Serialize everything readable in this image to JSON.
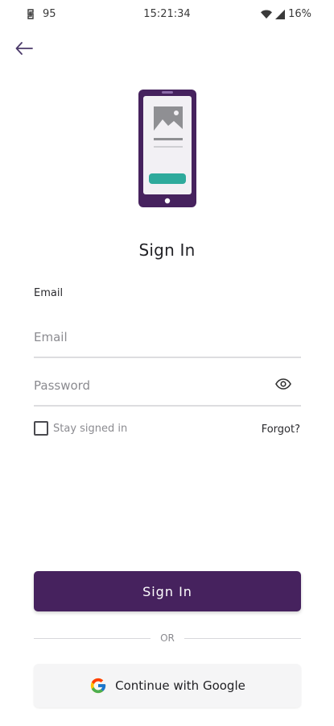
{
  "status_bar": {
    "notification_count": "95",
    "time": "15:21:34",
    "battery": "16%",
    "icons": [
      "notification-app-icon",
      "wifi-icon",
      "signal-icon"
    ]
  },
  "header": {
    "back_icon": "arrow-left-icon"
  },
  "illustration": {
    "icon": "phone-illustration-icon",
    "colors": {
      "frame": "#46225e",
      "screen": "#f2f0f4",
      "accent": "#2eaa9c",
      "image": "#8f8f93"
    }
  },
  "title": "Sign In",
  "form": {
    "email_label": "Email",
    "email_placeholder": "Email",
    "email_value": "",
    "password_placeholder": "Password",
    "password_value": "",
    "show_password_icon": "eye-icon",
    "stay_signed_in_label": "Stay signed in",
    "stay_signed_in_checked": false,
    "forgot_label": "Forgot?"
  },
  "actions": {
    "sign_in_label": "Sign In",
    "or_text": "OR",
    "google_label": "Continue with Google",
    "google_icon": "google-g-icon"
  },
  "colors": {
    "primary": "#46225e",
    "divider": "#dddde0",
    "muted_text": "#8b8b90"
  }
}
